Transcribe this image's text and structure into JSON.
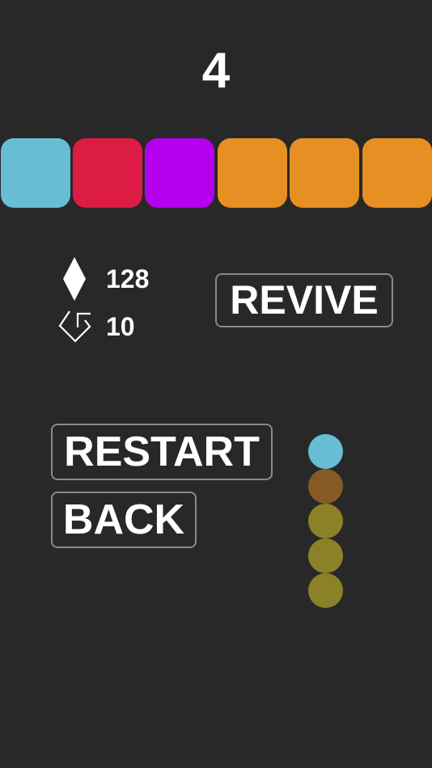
{
  "score": "4",
  "blocks": [
    {
      "color": "#66bdd4"
    },
    {
      "color": "#dd1c45"
    },
    {
      "color": "#b400ee"
    },
    {
      "color": "#e68f22"
    },
    {
      "color": "#e68f22"
    },
    {
      "color": "#e68f22"
    }
  ],
  "stats": {
    "gems": "128",
    "gem_icon": "diamond-icon",
    "revives": "10",
    "revive_icon": "revive-arrow-icon"
  },
  "buttons": {
    "revive": "REVIVE",
    "restart": "RESTART",
    "back": "BACK"
  },
  "snake": [
    {
      "color": "#66bdd4"
    },
    {
      "color": "#865a24"
    },
    {
      "color": "#8b8228"
    },
    {
      "color": "#8b8228"
    },
    {
      "color": "#8b8228"
    }
  ]
}
